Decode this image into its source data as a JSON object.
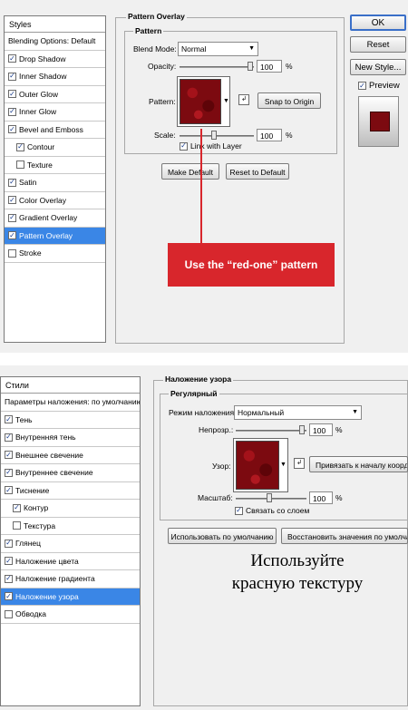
{
  "en": {
    "styles_header": "Styles",
    "items": [
      {
        "label": "Blending Options: Default",
        "checkbox": false,
        "checked": false,
        "sub": false,
        "selected": false
      },
      {
        "label": "Drop Shadow",
        "checkbox": true,
        "checked": true,
        "sub": false,
        "selected": false
      },
      {
        "label": "Inner Shadow",
        "checkbox": true,
        "checked": true,
        "sub": false,
        "selected": false
      },
      {
        "label": "Outer Glow",
        "checkbox": true,
        "checked": true,
        "sub": false,
        "selected": false
      },
      {
        "label": "Inner Glow",
        "checkbox": true,
        "checked": true,
        "sub": false,
        "selected": false
      },
      {
        "label": "Bevel and Emboss",
        "checkbox": true,
        "checked": true,
        "sub": false,
        "selected": false
      },
      {
        "label": "Contour",
        "checkbox": true,
        "checked": true,
        "sub": true,
        "selected": false
      },
      {
        "label": "Texture",
        "checkbox": true,
        "checked": false,
        "sub": true,
        "selected": false
      },
      {
        "label": "Satin",
        "checkbox": true,
        "checked": true,
        "sub": false,
        "selected": false
      },
      {
        "label": "Color Overlay",
        "checkbox": true,
        "checked": true,
        "sub": false,
        "selected": false
      },
      {
        "label": "Gradient Overlay",
        "checkbox": true,
        "checked": true,
        "sub": false,
        "selected": false
      },
      {
        "label": "Pattern Overlay",
        "checkbox": true,
        "checked": true,
        "sub": false,
        "selected": true
      },
      {
        "label": "Stroke",
        "checkbox": true,
        "checked": false,
        "sub": false,
        "selected": false
      }
    ],
    "group_title": "Pattern Overlay",
    "sub_title": "Pattern",
    "blend_label": "Blend Mode:",
    "blend_value": "Normal",
    "opacity_label": "Opacity:",
    "opacity_value": "100",
    "pattern_label": "Pattern:",
    "snap_button": "Snap to Origin",
    "scale_label": "Scale:",
    "scale_value": "100",
    "percent": "%",
    "link_label": "Link with Layer",
    "link_checked": true,
    "make_default": "Make Default",
    "reset_default": "Reset to Default",
    "ok": "OK",
    "reset": "Reset",
    "new_style": "New Style...",
    "preview_label": "Preview",
    "preview_checked": true,
    "callout": "Use the “red-one” pattern"
  },
  "ru": {
    "styles_header": "Стили",
    "items": [
      {
        "label": "Параметры наложения: по умолчанию",
        "checkbox": false,
        "checked": false,
        "sub": false,
        "selected": false
      },
      {
        "label": "Тень",
        "checkbox": true,
        "checked": true,
        "sub": false,
        "selected": false
      },
      {
        "label": "Внутренняя тень",
        "checkbox": true,
        "checked": true,
        "sub": false,
        "selected": false
      },
      {
        "label": "Внешнее свечение",
        "checkbox": true,
        "checked": true,
        "sub": false,
        "selected": false
      },
      {
        "label": "Внутреннее свечение",
        "checkbox": true,
        "checked": true,
        "sub": false,
        "selected": false
      },
      {
        "label": "Тиснение",
        "checkbox": true,
        "checked": true,
        "sub": false,
        "selected": false
      },
      {
        "label": "Контур",
        "checkbox": true,
        "checked": true,
        "sub": true,
        "selected": false
      },
      {
        "label": "Текстура",
        "checkbox": true,
        "checked": false,
        "sub": true,
        "selected": false
      },
      {
        "label": "Глянец",
        "checkbox": true,
        "checked": true,
        "sub": false,
        "selected": false
      },
      {
        "label": "Наложение цвета",
        "checkbox": true,
        "checked": true,
        "sub": false,
        "selected": false
      },
      {
        "label": "Наложение градиента",
        "checkbox": true,
        "checked": true,
        "sub": false,
        "selected": false
      },
      {
        "label": "Наложение узора",
        "checkbox": true,
        "checked": true,
        "sub": false,
        "selected": true
      },
      {
        "label": "Обводка",
        "checkbox": true,
        "checked": false,
        "sub": false,
        "selected": false
      }
    ],
    "group_title": "Наложение узора",
    "sub_title": "Регулярный",
    "blend_label": "Режим наложения:",
    "blend_value": "Нормальный",
    "opacity_label": "Непрозр.:",
    "opacity_value": "100",
    "pattern_label": "Узор:",
    "snap_button": "Привязать к началу коорди",
    "scale_label": "Масштаб:",
    "scale_value": "100",
    "percent": "%",
    "link_label": "Связать со слоем",
    "link_checked": true,
    "make_default": "Использовать по умолчанию",
    "reset_default": "Восстановить значения по умолча",
    "caption_line1": "Используйте",
    "caption_line2": "красную текстуру"
  },
  "colors": {
    "selection": "#3a86e6",
    "callout_bg": "#d8262c",
    "callout_line": "#d8262c",
    "pattern": "#7c0a10",
    "dialog_bg": "#f0f0f0"
  }
}
